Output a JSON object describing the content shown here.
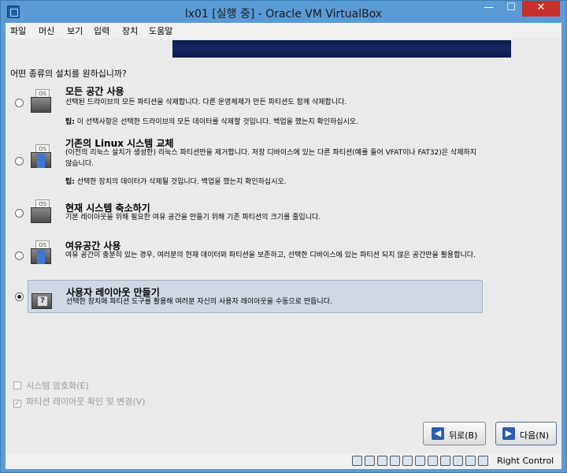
{
  "window": {
    "title": "lx01 [실행 중] - Oracle VM VirtualBox",
    "min_glyph": "—",
    "max_glyph": "☐",
    "close_glyph": "✕"
  },
  "menu": [
    "파일",
    "머신",
    "보기",
    "입력",
    "장치",
    "도움말"
  ],
  "installer": {
    "question": "어떤 종류의 설치를 원하십니까?",
    "options": [
      {
        "title": "모든 공간 사용",
        "desc": "선택된 드라이브의 모든 파티션을 삭제합니다. 다른 운영체제가 만든 파티션도 함께 삭제합니다.",
        "tip_label": "팁:",
        "tip": " 이 선택사항은 선택한 드라이브의 모든 데이터를 삭제할 것입니다. 백업을 했는지 확인하십시오.",
        "icon": "disk-full-icon",
        "selected": false
      },
      {
        "title": "기존의 Linux 시스템 교체",
        "desc": "(이전의 리눅스 설치가 생성한) 리눅스 파티션만을 제거합니다. 저장 디바이스에 있는 다른 파티션(예를 들어 VFAT이나 FAT32)은 삭제하지 않습니다.",
        "tip_label": "팁:",
        "tip": " 선택한 장치의 데이터가 삭제될 것입니다. 백업을 했는지 확인하십시오.",
        "icon": "disk-replace-icon",
        "selected": false
      },
      {
        "title": "현재 시스템 축소하기",
        "desc": "기본 레이아웃을 위해 필요한 여유 공간을 만들기 위해 기존 파티션의 크기를 줄입니다.",
        "icon": "disk-shrink-icon",
        "selected": false
      },
      {
        "title": "여유공간 사용",
        "desc": "여유 공간이 충분히 있는 경우, 여러분의 현재 데이터와 파티션을 보존하고, 선택한 디바이스에 있는 파티션 되지 않은 공간만을 활용합니다.",
        "icon": "disk-free-space-icon",
        "selected": false
      },
      {
        "title": "사용자 레이아웃 만들기",
        "desc": "선택한 장치에 파티션 도구를 활용해 여러분 자신의 사용자 레이아웃을 수동으로 만듭니다.",
        "icon": "disk-custom-icon",
        "selected": true
      }
    ],
    "checkboxes": [
      {
        "label": "시스템 암호화(E)",
        "checked": false,
        "disabled": true
      },
      {
        "label": "파티션 레이아웃 확인 및 변경(V)",
        "checked": true,
        "disabled": true
      }
    ],
    "back_label": "뒤로(B)",
    "next_label": "다음(N)"
  },
  "status": {
    "host_key": "Right Control"
  },
  "colors": {
    "accent": "#2a5db0",
    "banner": "#0a1a4a",
    "selection": "#cfd8e4"
  }
}
